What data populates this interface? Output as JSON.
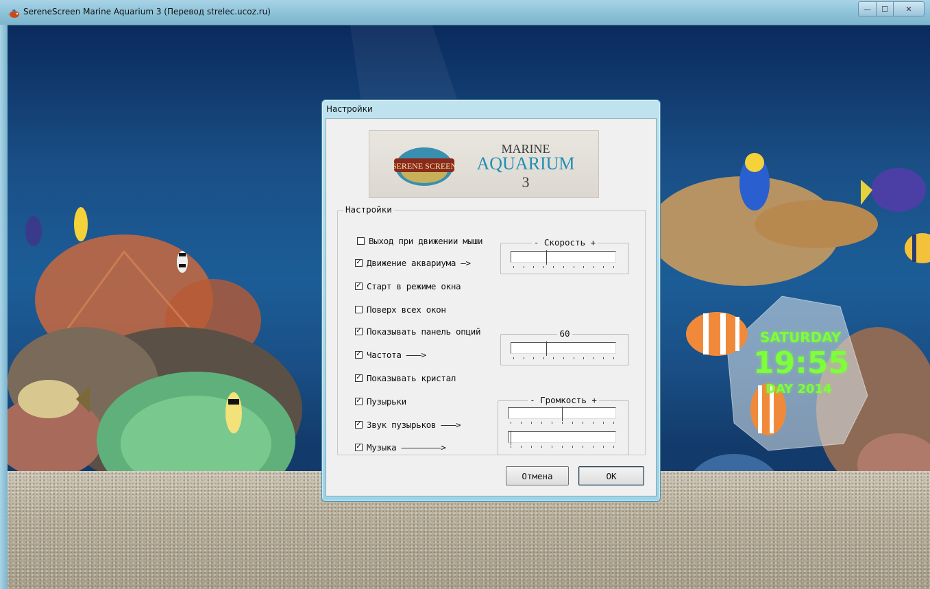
{
  "app": {
    "title": "SereneScreen Marine Aquarium 3 (Перевод strelec.ucoz.ru)",
    "window_buttons": {
      "minimize": "—",
      "maximize": "☐",
      "close": "✕"
    }
  },
  "scene": {
    "clock_day": "SATURDAY",
    "clock_time": "19:55",
    "clock_date": "DAY 2014"
  },
  "dialog": {
    "title": "Настройки",
    "logo": {
      "brand": "SERENE SCREEN",
      "line1": "MARINE",
      "line2": "AQUARIUM",
      "line3": "3"
    },
    "group_label": "Настройки",
    "options": [
      {
        "label": "Выход при движении мыши",
        "checked": false
      },
      {
        "label": "Движение аквариума –>",
        "checked": true
      },
      {
        "label": "Старт в режиме окна",
        "checked": true
      },
      {
        "label": "Поверх всех окон",
        "checked": false
      },
      {
        "label": "Показывать панель опций",
        "checked": true
      },
      {
        "label": "Частота ———>",
        "checked": true
      },
      {
        "label": "Показывать кристал",
        "checked": true
      },
      {
        "label": "Пузырьки",
        "checked": true
      },
      {
        "label": "Звук пузырьков ———>",
        "checked": true
      },
      {
        "label": "Музыка ————————>",
        "checked": true
      }
    ],
    "speed": {
      "label": "- Скорость +",
      "value": 0.35
    },
    "frequency": {
      "label": "60",
      "value": 0.35
    },
    "volume": {
      "label": "- Громкость +",
      "bubbles_value": 0.52,
      "music_value": 0.02
    },
    "cancel_label": "Отмена",
    "ok_label": "OK"
  },
  "colors": {
    "title_bar": "#9fd3e6",
    "dialog_bg": "#f0f0f0",
    "water": "#1a4f86",
    "clock": "#7dff3a"
  },
  "icons": [
    "fish-app-icon",
    "minimize-icon",
    "maximize-icon",
    "close-icon"
  ]
}
